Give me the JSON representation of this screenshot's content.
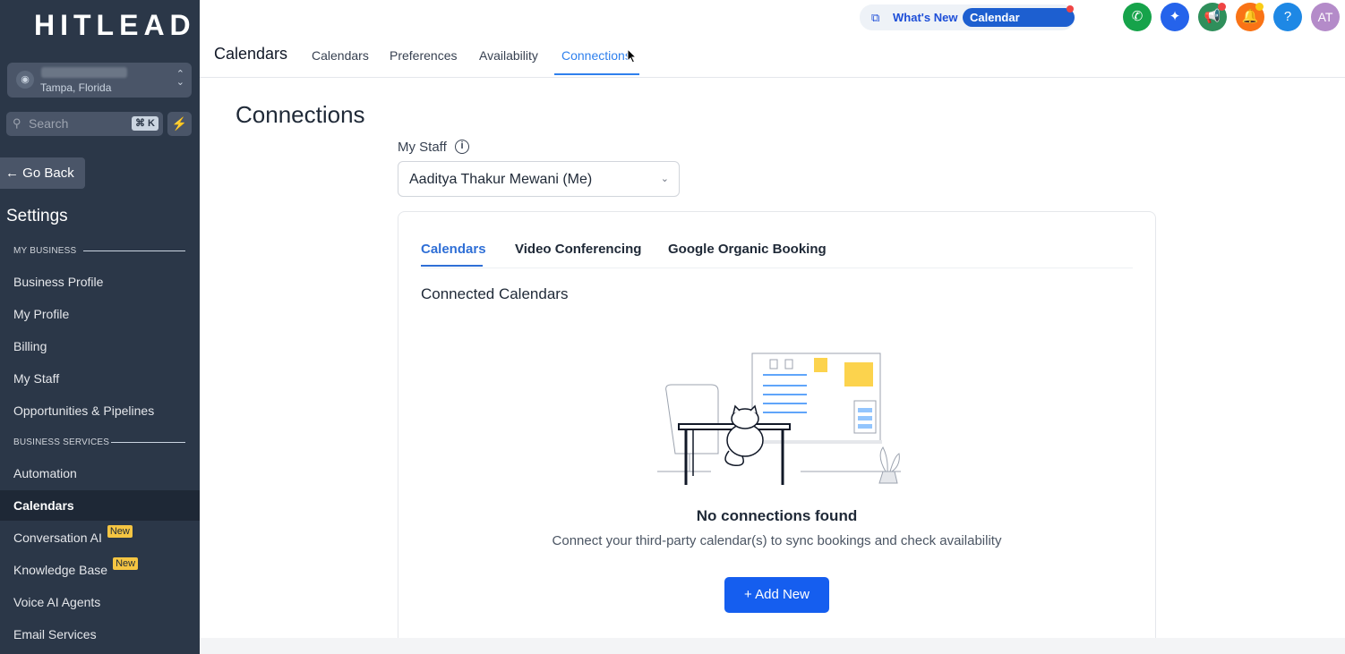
{
  "sidebar": {
    "logo": "HITLEAD",
    "location_sub": "Tampa, Florida",
    "search_placeholder": "Search",
    "search_shortcut": "⌘ K",
    "go_back": "Go Back",
    "settings_title": "Settings",
    "section_business": "MY BUSINESS",
    "section_services": "BUSINESS SERVICES",
    "items": [
      {
        "label": "Business Profile"
      },
      {
        "label": "My Profile"
      },
      {
        "label": "Billing"
      },
      {
        "label": "My Staff"
      },
      {
        "label": "Opportunities & Pipelines"
      },
      {
        "label": "Automation"
      },
      {
        "label": "Calendars"
      },
      {
        "label": "Conversation AI",
        "badge": "New"
      },
      {
        "label": "Knowledge Base",
        "badge": "New"
      },
      {
        "label": "Voice AI Agents"
      },
      {
        "label": "Email Services"
      }
    ]
  },
  "topbar": {
    "title": "Calendars",
    "tabs": [
      "Calendars",
      "Preferences",
      "Availability",
      "Connections"
    ],
    "whats_new": "What's New",
    "calendar_updates": "Calendar Updates",
    "avatar": "AT",
    "help": "?"
  },
  "main": {
    "title": "Connections",
    "staff_label": "My Staff",
    "staff_value": "Aaditya Thakur Mewani (Me)",
    "card_tabs": [
      "Calendars",
      "Video Conferencing",
      "Google Organic Booking"
    ],
    "connected_title": "Connected Calendars",
    "empty_title": "No connections found",
    "empty_sub": "Connect your third-party calendar(s) to sync bookings and check availability",
    "add_button": "Add New"
  },
  "colors": {
    "sidebar_bg": "#2b3748",
    "accent": "#2f80ed",
    "primary_button": "#155eef",
    "badge": "#f5c542"
  }
}
